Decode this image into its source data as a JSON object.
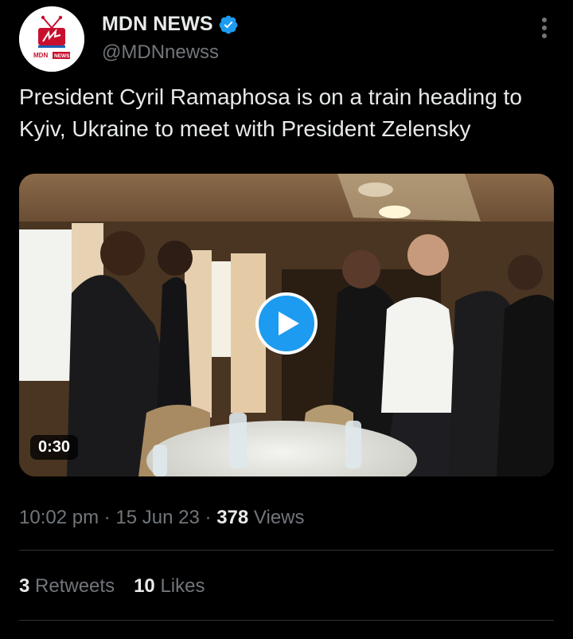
{
  "author": {
    "display_name": "MDN NEWS",
    "handle": "@MDNnewss",
    "verified": true,
    "avatar_text_left": "MDN",
    "avatar_text_right": "NEWS"
  },
  "tweet": {
    "text": "President Cyril Ramaphosa is on a train heading to Kyiv, Ukraine to meet with President Zelensky",
    "time": "10:02 pm",
    "date": "15 Jun 23",
    "views_count": "378",
    "views_label": "Views",
    "separator": "·"
  },
  "media": {
    "type": "video",
    "duration": "0:30",
    "play_icon": "play-icon"
  },
  "engagement": {
    "retweets_count": "3",
    "retweets_label": "Retweets",
    "likes_count": "10",
    "likes_label": "Likes"
  },
  "colors": {
    "background": "#000000",
    "text_primary": "#e7e9ea",
    "text_secondary": "#71767b",
    "accent": "#1d9bf0",
    "divider": "#2f3336"
  }
}
